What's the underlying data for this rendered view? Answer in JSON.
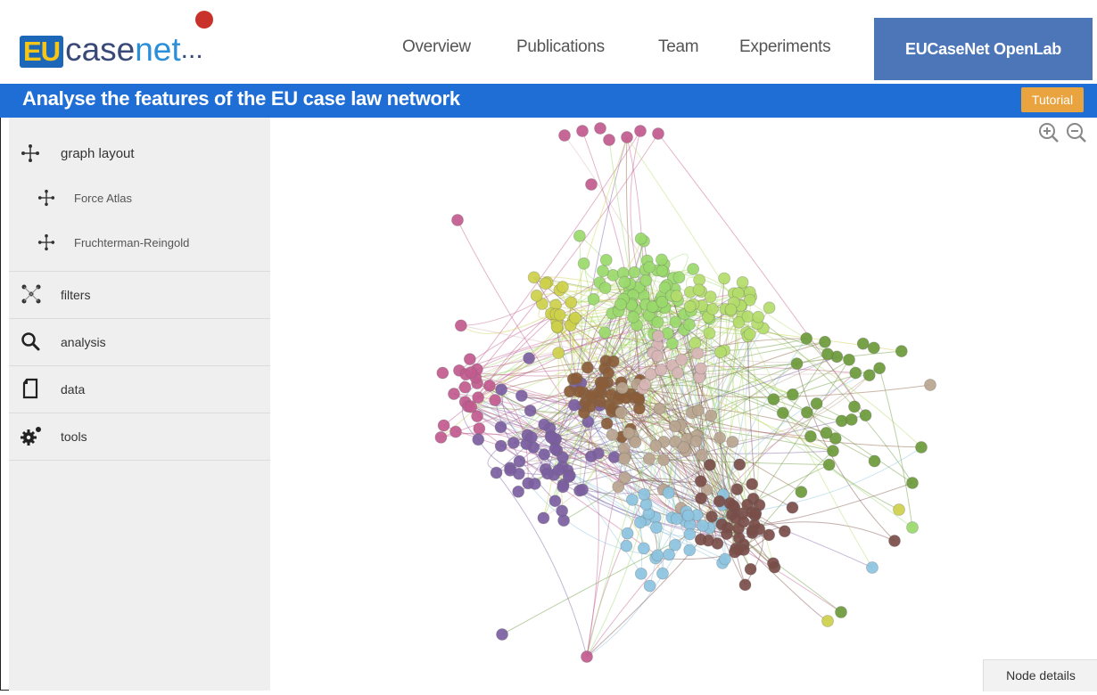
{
  "brand": {
    "logo_eu": "EU",
    "logo_case": "case",
    "logo_net": "net",
    "logo_dots": "..."
  },
  "nav": {
    "items": [
      {
        "label": "Overview"
      },
      {
        "label": "Publications"
      },
      {
        "label": "Team"
      },
      {
        "label": "Experiments"
      },
      {
        "label": "EUCaseNet OpenLab",
        "active": true
      }
    ]
  },
  "titlebar": {
    "title": "Analyse the features of the EU case law network",
    "tutorial_label": "Tutorial"
  },
  "sidebar": {
    "graph_layout": {
      "label": "graph layout",
      "icon": "graph-layout-icon",
      "options": [
        {
          "label": "Force Atlas",
          "icon": "layout-option-icon"
        },
        {
          "label": "Fruchterman-Reingold",
          "icon": "layout-option-icon"
        }
      ]
    },
    "filters": {
      "label": "filters",
      "icon": "filters-icon"
    },
    "analysis": {
      "label": "analysis",
      "icon": "search-icon"
    },
    "data": {
      "label": "data",
      "icon": "document-icon"
    },
    "tools": {
      "label": "tools",
      "icon": "gears-icon"
    }
  },
  "graph": {
    "zoom_in_icon": "zoom-in-icon",
    "zoom_out_icon": "zoom-out-icon",
    "node_details_label": "Node details",
    "cluster_colors": [
      "#9ad96b",
      "#b3dc6a",
      "#cdd04a",
      "#6b9a3a",
      "#c15a8e",
      "#7b5ea1",
      "#8a5c38",
      "#b8a48f",
      "#8cc3e0",
      "#7a4d48",
      "#d7b5b5"
    ]
  },
  "colors": {
    "title_bar": "#1f6ed6",
    "nav_active": "#4c76b8",
    "tutorial": "#e9a33f",
    "sidebar_bg": "#efefef"
  }
}
